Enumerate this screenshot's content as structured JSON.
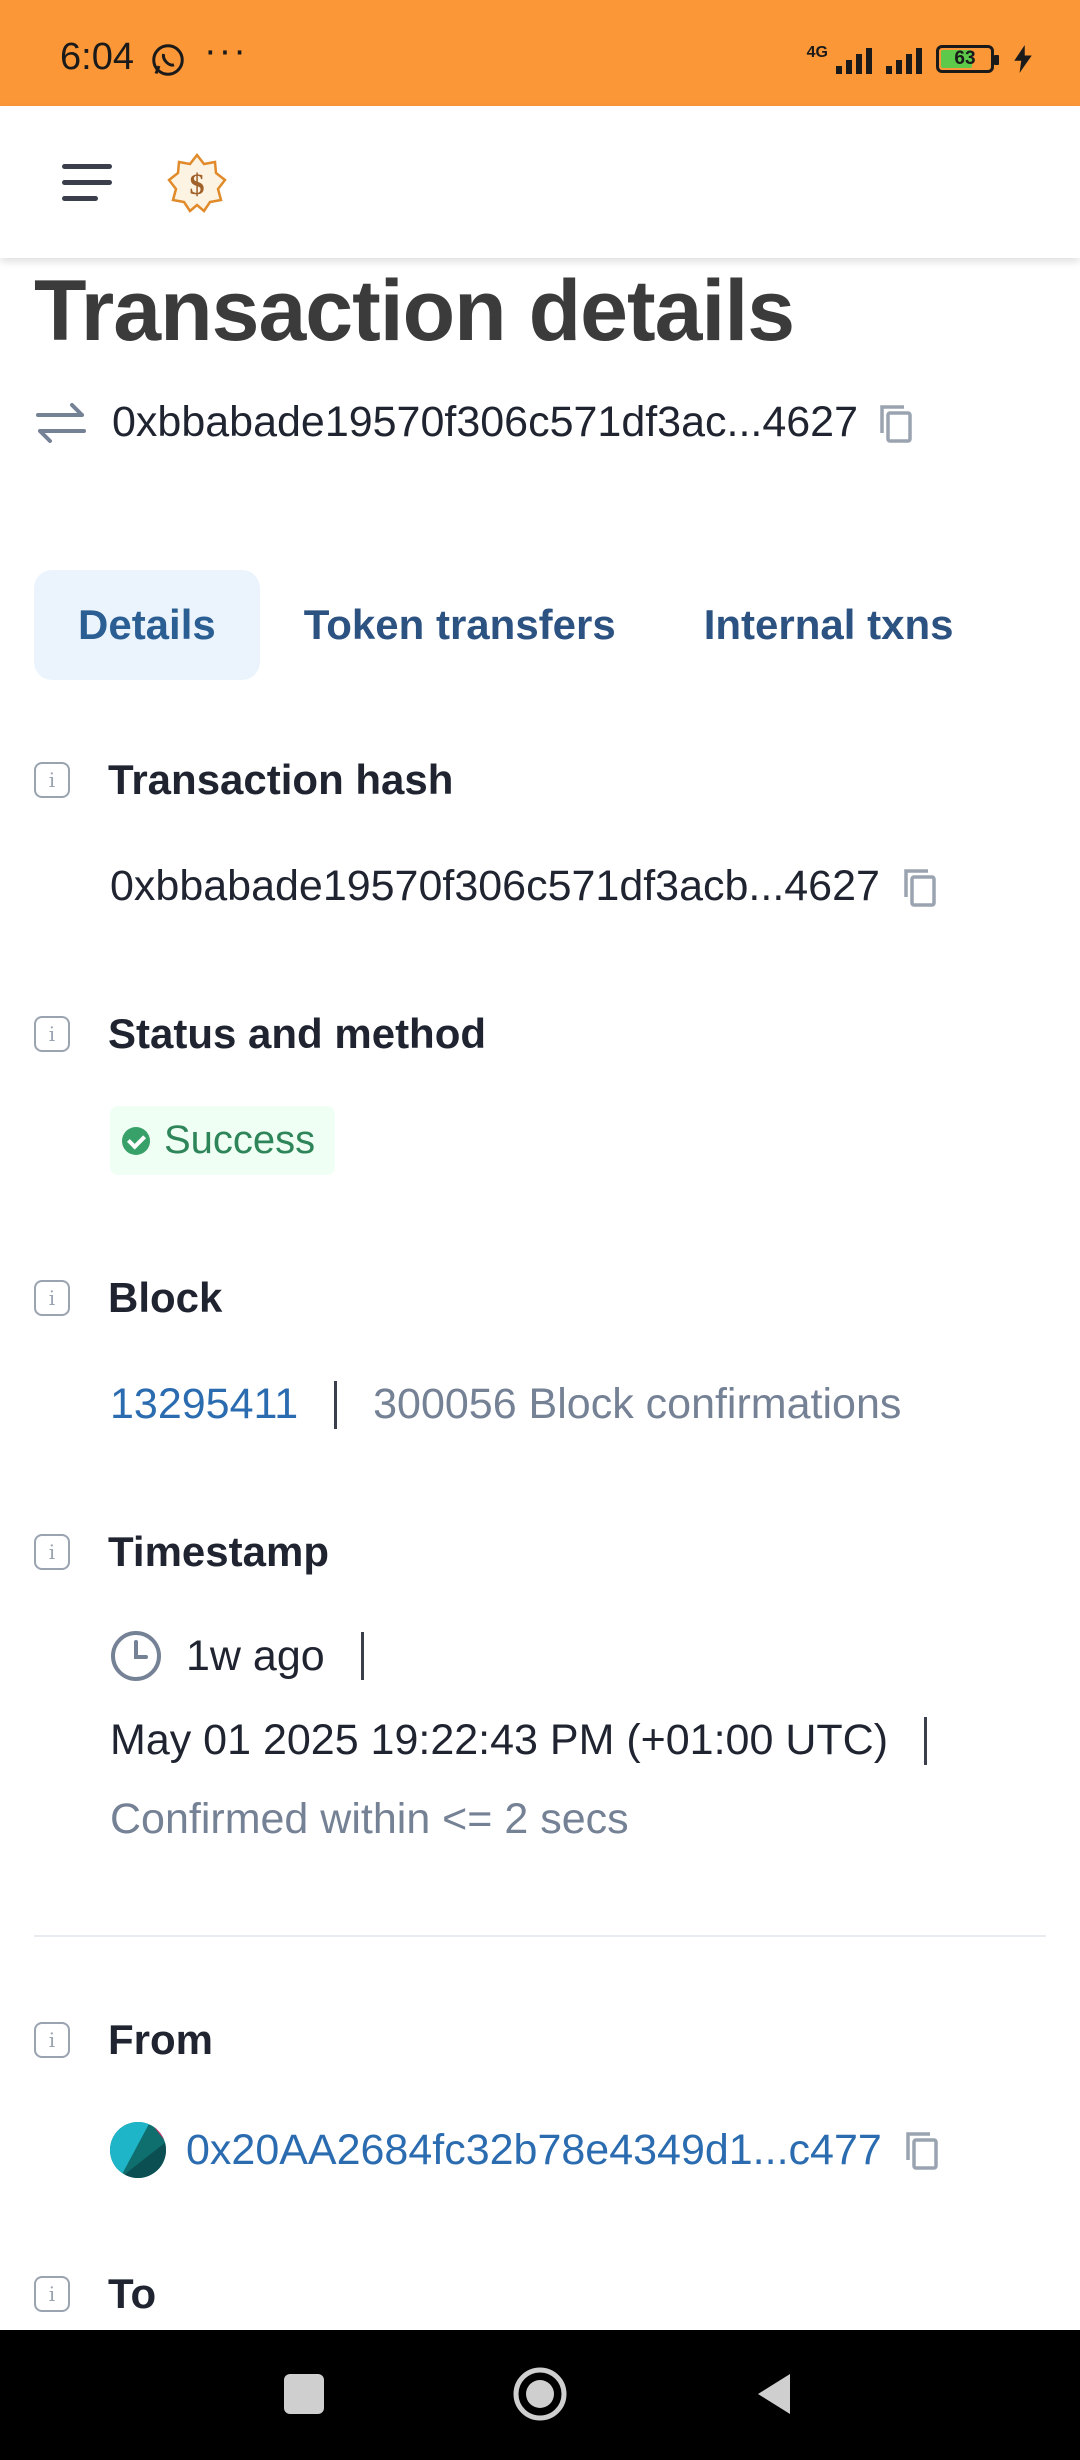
{
  "status_bar": {
    "time": "6:04",
    "network": "4G",
    "battery": "63",
    "icons": [
      "whatsapp-icon",
      "more-dots-icon",
      "signal-icon",
      "battery-icon",
      "charging-icon"
    ],
    "battery_level": 0.63
  },
  "header": {
    "icons": [
      "menu-icon",
      "blockscout-logo-icon"
    ]
  },
  "page": {
    "title": "Transaction details",
    "tx_hash_short": "0xbbabade19570f306c571df3ac...4627"
  },
  "tabs": [
    {
      "label": "Details",
      "active": true
    },
    {
      "label": "Token transfers",
      "active": false
    },
    {
      "label": "Internal txns",
      "active": false
    }
  ],
  "sections": {
    "tx_hash": {
      "label": "Transaction hash",
      "value": "0xbbabade19570f306c571df3acb...4627"
    },
    "status": {
      "label": "Status and method",
      "value": "Success"
    },
    "block": {
      "label": "Block",
      "number": "13295411",
      "confirmations": "300056 Block confirmations"
    },
    "timestamp": {
      "label": "Timestamp",
      "relative": "1w ago",
      "absolute": "May 01 2025 19:22:43 PM (+01:00 UTC)",
      "confirmed": "Confirmed within <= 2 secs"
    },
    "from": {
      "label": "From",
      "address": "0x20AA2684fc32b78e4349d1...c477"
    },
    "to": {
      "label": "To"
    }
  },
  "colors": {
    "status_bar": "#fb9737",
    "tab_active_bg": "#ebf4fd",
    "link": "#2b6cb0",
    "success": "#2f855a"
  }
}
